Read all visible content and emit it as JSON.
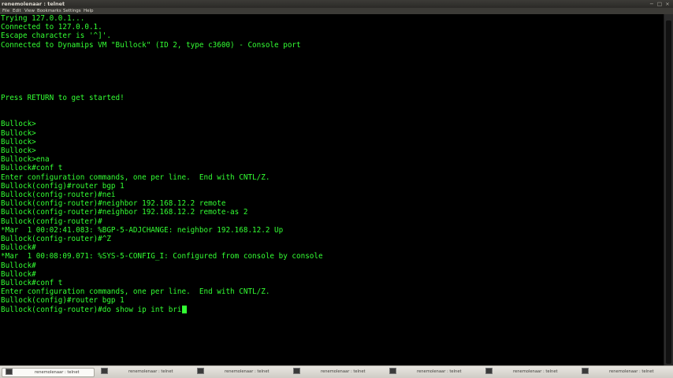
{
  "window": {
    "title": "renemolenaar : telnet",
    "controls": [
      "−",
      "□",
      "×"
    ]
  },
  "menu": [
    "File",
    "Edit",
    "View",
    "Bookmarks",
    "Settings",
    "Help"
  ],
  "terminal": {
    "lines": [
      "Trying 127.0.0.1...",
      "Connected to 127.0.0.1.",
      "Escape character is '^]'.",
      "Connected to Dynamips VM \"Bullock\" (ID 2, type c3600) - Console port",
      "",
      "",
      "",
      "",
      "",
      "Press RETURN to get started!",
      "",
      "",
      "Bullock>",
      "Bullock>",
      "Bullock>",
      "Bullock>",
      "Bullock>ena",
      "Bullock#conf t",
      "Enter configuration commands, one per line.  End with CNTL/Z.",
      "Bullock(config)#router bgp 1",
      "Bullock(config-router)#nei",
      "Bullock(config-router)#neighbor 192.168.12.2 remote",
      "Bullock(config-router)#neighbor 192.168.12.2 remote-as 2",
      "Bullock(config-router)#",
      "*Mar  1 00:02:41.083: %BGP-5-ADJCHANGE: neighbor 192.168.12.2 Up",
      "Bullock(config-router)#^Z",
      "Bullock#",
      "*Mar  1 00:08:09.071: %SYS-5-CONFIG_I: Configured from console by console",
      "Bullock#",
      "Bullock#",
      "Bullock#conf t",
      "Enter configuration commands, one per line.  End with CNTL/Z.",
      "Bullock(config)#router bgp 1",
      "Bullock(config-router)#do show ip int bri"
    ],
    "text_color": "#33ff33",
    "background": "#000000"
  },
  "taskbar": {
    "tasks": [
      {
        "label": "renemolenaar : telnet",
        "active": true
      },
      {
        "label": "renemolenaar : telnet",
        "active": false
      },
      {
        "label": "renemolenaar : telnet",
        "active": false
      },
      {
        "label": "renemolenaar : telnet",
        "active": false
      },
      {
        "label": "renemolenaar : telnet",
        "active": false
      },
      {
        "label": "renemolenaar : telnet",
        "active": false
      },
      {
        "label": "renemolenaar : telnet",
        "active": false
      }
    ]
  }
}
